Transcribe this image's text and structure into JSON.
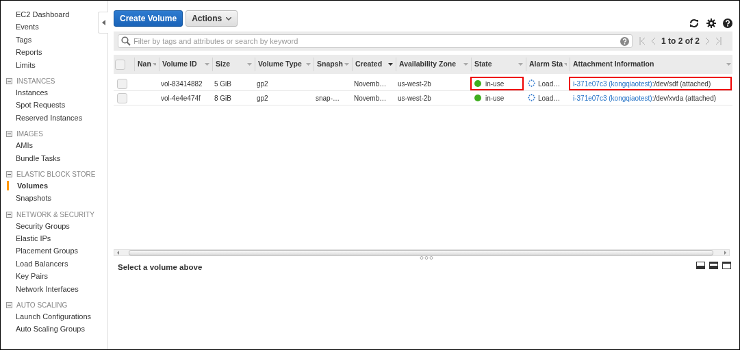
{
  "sidebar": {
    "items": [
      {
        "kind": "link",
        "label": "EC2 Dashboard",
        "selected": false
      },
      {
        "kind": "link",
        "label": "Events",
        "selected": false
      },
      {
        "kind": "link",
        "label": "Tags",
        "selected": false
      },
      {
        "kind": "link",
        "label": "Reports",
        "selected": false
      },
      {
        "kind": "link",
        "label": "Limits",
        "selected": false
      },
      {
        "kind": "section",
        "label": "INSTANCES",
        "expanded": true
      },
      {
        "kind": "link",
        "label": "Instances",
        "selected": false
      },
      {
        "kind": "link",
        "label": "Spot Requests",
        "selected": false
      },
      {
        "kind": "link",
        "label": "Reserved Instances",
        "selected": false
      },
      {
        "kind": "section",
        "label": "IMAGES",
        "expanded": true
      },
      {
        "kind": "link",
        "label": "AMIs",
        "selected": false
      },
      {
        "kind": "link",
        "label": "Bundle Tasks",
        "selected": false
      },
      {
        "kind": "section",
        "label": "ELASTIC BLOCK STORE",
        "expanded": true
      },
      {
        "kind": "link",
        "label": "Volumes",
        "selected": true
      },
      {
        "kind": "link",
        "label": "Snapshots",
        "selected": false
      },
      {
        "kind": "section",
        "label": "NETWORK & SECURITY",
        "expanded": true
      },
      {
        "kind": "link",
        "label": "Security Groups",
        "selected": false
      },
      {
        "kind": "link",
        "label": "Elastic IPs",
        "selected": false
      },
      {
        "kind": "link",
        "label": "Placement Groups",
        "selected": false
      },
      {
        "kind": "link",
        "label": "Load Balancers",
        "selected": false
      },
      {
        "kind": "link",
        "label": "Key Pairs",
        "selected": false
      },
      {
        "kind": "link",
        "label": "Network Interfaces",
        "selected": false
      },
      {
        "kind": "section",
        "label": "AUTO SCALING",
        "expanded": true
      },
      {
        "kind": "link",
        "label": "Launch Configurations",
        "selected": false
      },
      {
        "kind": "link",
        "label": "Auto Scaling Groups",
        "selected": false
      }
    ]
  },
  "toolbar": {
    "primary_button": "Create Volume",
    "actions_button": "Actions"
  },
  "filter": {
    "placeholder": "Filter by tags and attributes or search by keyword"
  },
  "pagination": {
    "text": "1 to 2 of 2"
  },
  "table": {
    "select_all": {
      "checked": false
    },
    "columns": [
      {
        "label": "Nan",
        "sorted": false
      },
      {
        "label": "Volume ID",
        "sorted": false
      },
      {
        "label": "Size",
        "sorted": false
      },
      {
        "label": "Volume Type",
        "sorted": false
      },
      {
        "label": "Snapsh",
        "sorted": false
      },
      {
        "label": "Created",
        "sorted": true
      },
      {
        "label": "Availability Zone",
        "sorted": false
      },
      {
        "label": "State",
        "sorted": false
      },
      {
        "label": "Alarm Sta",
        "sorted": false
      },
      {
        "label": "Attachment Information",
        "sorted": false
      }
    ],
    "rows": [
      {
        "checked": false,
        "volume_id": "vol-83414882",
        "size": "5 GiB",
        "volume_type": "gp2",
        "created": "Novemb…",
        "zone": "us-west-2b",
        "state": "in-use",
        "state_highlighted": true,
        "alarm": "Load…",
        "attachment_link": "i-371e07c3 (kongqiaotest)",
        "attachment_rest": ":/dev/sdf (attached)",
        "attachment_highlighted": true
      },
      {
        "checked": false,
        "volume_id": "vol-4e4e474f",
        "size": "8 GiB",
        "volume_type": "gp2",
        "snapshot": "snap-…",
        "created": "Novemb…",
        "zone": "us-west-2b",
        "state": "in-use",
        "state_highlighted": false,
        "alarm": "Load…",
        "attachment_link": "i-371e07c3 (kongqiaotest)",
        "attachment_rest": ":/dev/xvda (attached)",
        "attachment_highlighted": false
      }
    ]
  },
  "details": {
    "message": "Select a volume above"
  }
}
